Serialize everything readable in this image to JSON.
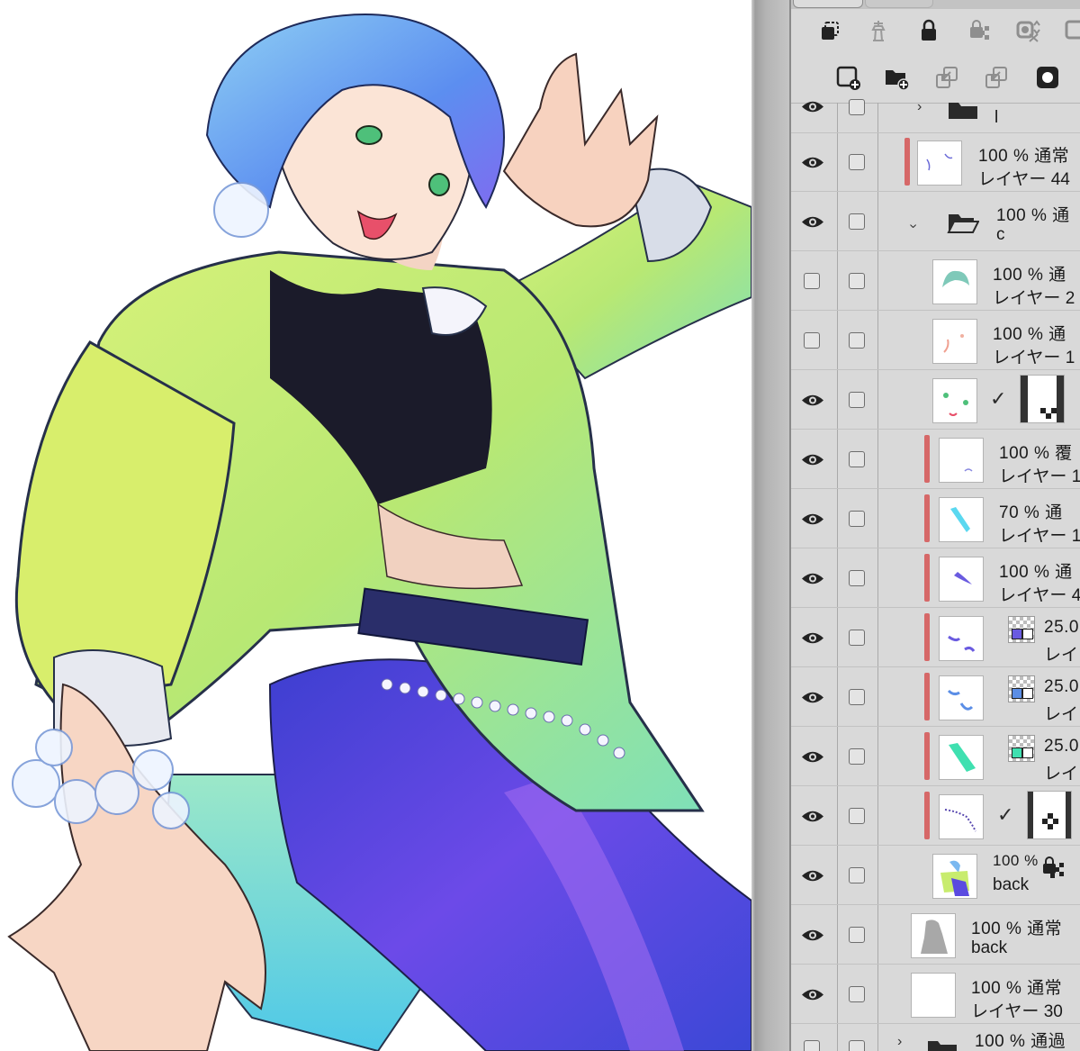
{
  "layer_panel": {
    "layers": [
      {
        "id": "top-folder",
        "opacity": "",
        "name": "l",
        "visible": true
      },
      {
        "id": "layer-44",
        "opacity": "100 %",
        "blend": "通常",
        "name": "レイヤー 44",
        "visible": true
      },
      {
        "id": "folder-c",
        "opacity": "100 %",
        "blend": "通",
        "name": "c",
        "visible": true
      },
      {
        "id": "layer-2",
        "opacity": "100 %",
        "blend": "通",
        "name": "レイヤー 2",
        "visible": false
      },
      {
        "id": "layer-1",
        "opacity": "100 %",
        "blend": "通",
        "name": "レイヤー 1",
        "visible": false
      },
      {
        "id": "masked-layer",
        "opacity": "",
        "name": "",
        "visible": true
      },
      {
        "id": "layer-11",
        "opacity": "100 %",
        "blend": "覆",
        "name": "レイヤー 1(",
        "visible": true
      },
      {
        "id": "layer-10",
        "opacity": "70 %",
        "blend": "通",
        "name": "レイヤー 1(",
        "visible": true
      },
      {
        "id": "layer-4",
        "opacity": "100 %",
        "blend": "通",
        "name": "レイヤー 4",
        "visible": true
      },
      {
        "id": "tone-purple",
        "opacity": "25.0",
        "name": "レイ",
        "visible": true,
        "swatch": "#6a5be0"
      },
      {
        "id": "tone-blue",
        "opacity": "25.0",
        "name": "レイ",
        "visible": true,
        "swatch": "#5b8ee6"
      },
      {
        "id": "tone-green",
        "opacity": "25.0",
        "name": "レイ",
        "visible": true,
        "swatch": "#3fe0b0"
      },
      {
        "id": "beads-layer",
        "opacity": "",
        "name": "",
        "visible": true
      },
      {
        "id": "back-ref",
        "opacity": "100 %",
        "name": "back",
        "visible": true
      },
      {
        "id": "back",
        "opacity": "100 %",
        "blend": "通常",
        "name": "back",
        "visible": true
      },
      {
        "id": "layer-30",
        "opacity": "100 %",
        "blend": "通常",
        "name": "レイヤー 30",
        "visible": true
      },
      {
        "id": "bottom-folder",
        "opacity": "100 %",
        "blend": "通過",
        "name": "",
        "visible": false
      }
    ]
  },
  "colors": {
    "panel_bg": "#d9d9d9",
    "clip_bar": "#d66868",
    "jacket": "#c8ec6e",
    "hair": "#7ab8f0",
    "pants": "#5a4ae0"
  },
  "icons": [
    "clip-layer-icon",
    "reference-layer-icon",
    "lock-icon",
    "lock-transparency-icon",
    "mask-toggle-icon",
    "color-layer-icon",
    "new-raster-layer-icon",
    "new-folder-icon",
    "transfer-down-icon",
    "combine-down-icon",
    "layer-mask-icon"
  ]
}
